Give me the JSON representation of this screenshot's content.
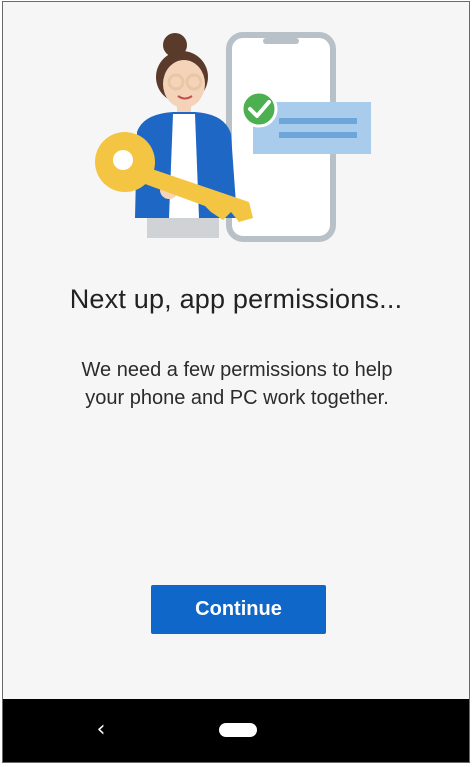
{
  "screen": {
    "title": "Next up, app permissions...",
    "body": "We need a few permissions to help your phone and PC work together.",
    "continue_label": "Continue"
  },
  "illustration": {
    "subject": "person-holding-key-beside-phone-with-checkmark",
    "icons": [
      "key-icon",
      "phone-icon",
      "checkmark-icon",
      "message-card-icon"
    ]
  },
  "navbar": {
    "back_icon": "‹",
    "home_icon": "home-pill-icon"
  },
  "colors": {
    "accent": "#0f67c9",
    "background": "#f6f6f7",
    "navbar": "#000000",
    "check": "#4caf50",
    "key": "#f4c542"
  }
}
